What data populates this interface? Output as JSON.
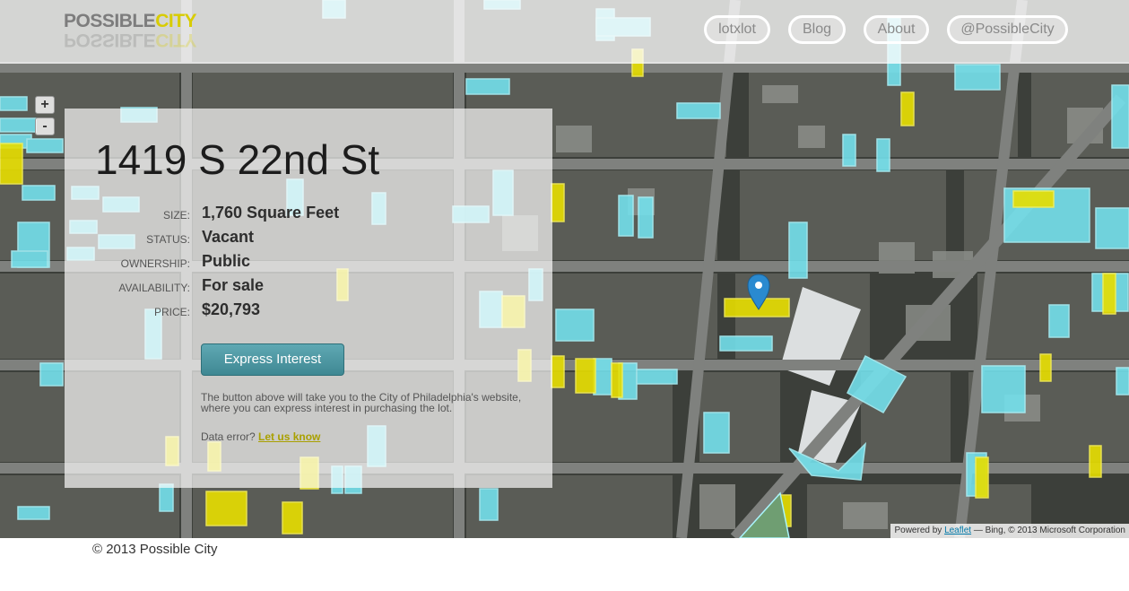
{
  "header": {
    "logo_part1": "POSSIBLE",
    "logo_part2": "CITY",
    "nav": [
      "lotxlot",
      "Blog",
      "About",
      "@PossibleCity"
    ]
  },
  "zoom": {
    "in_label": "+",
    "out_label": "-"
  },
  "lot": {
    "address": "1419 S 22nd St",
    "details": [
      {
        "label": "SIZE:",
        "value": "1,760 Square Feet"
      },
      {
        "label": "STATUS:",
        "value": "Vacant"
      },
      {
        "label": "OWNERSHIP:",
        "value": "Public"
      },
      {
        "label": "AVAILABILITY:",
        "value": "For sale"
      },
      {
        "label": "PRICE:",
        "value": "$20,793"
      }
    ],
    "button_label": "Express Interest",
    "note": "The button above will take you to the City of Philadelphia's website, where you can express interest in purchasing the lot.",
    "error_prefix": "Data error?",
    "error_link": "Let us know"
  },
  "attribution": {
    "prefix": "Powered by",
    "link": "Leaflet",
    "suffix": "— Bing, © 2013 Microsoft Corporation"
  },
  "footer": {
    "copyright": "© 2013 Possible City"
  },
  "colors": {
    "vacant_public": "#e7de00",
    "vacant_private": "#74e3ef",
    "marker": "#2a8ad0",
    "button": "#4a929c",
    "logo_accent": "#d8cc00"
  },
  "icons": {
    "marker": "map-marker-icon"
  }
}
